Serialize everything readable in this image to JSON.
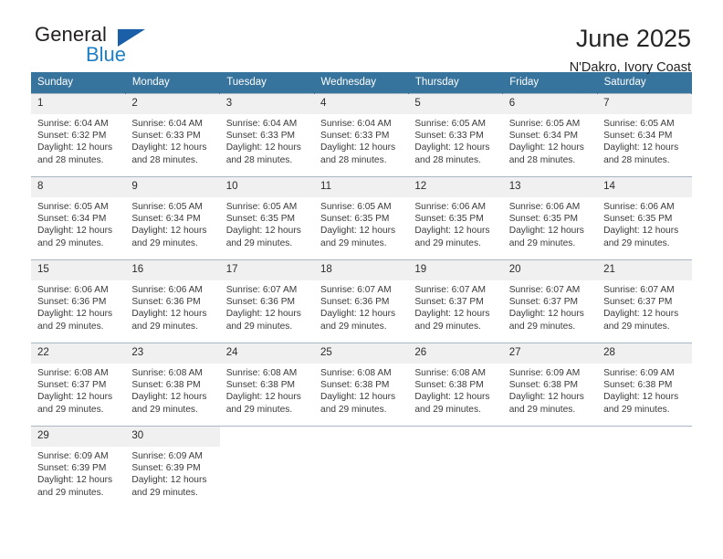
{
  "brand": {
    "line1": "General",
    "line2": "Blue",
    "flag_icon": "triangle-flag-icon",
    "accent_color": "#1f7fc4",
    "flag_color": "#1a5fa8"
  },
  "header": {
    "title": "June 2025",
    "subtitle": "N'Dakro, Ivory Coast"
  },
  "calendar": {
    "header_color": "#36739d",
    "daynum_background": "#f0f0f0",
    "weekdays": [
      "Sunday",
      "Monday",
      "Tuesday",
      "Wednesday",
      "Thursday",
      "Friday",
      "Saturday"
    ],
    "weeks": [
      [
        {
          "day": "1",
          "sunrise": "Sunrise: 6:04 AM",
          "sunset": "Sunset: 6:32 PM",
          "daylight_line1": "Daylight: 12 hours",
          "daylight_line2": "and 28 minutes."
        },
        {
          "day": "2",
          "sunrise": "Sunrise: 6:04 AM",
          "sunset": "Sunset: 6:33 PM",
          "daylight_line1": "Daylight: 12 hours",
          "daylight_line2": "and 28 minutes."
        },
        {
          "day": "3",
          "sunrise": "Sunrise: 6:04 AM",
          "sunset": "Sunset: 6:33 PM",
          "daylight_line1": "Daylight: 12 hours",
          "daylight_line2": "and 28 minutes."
        },
        {
          "day": "4",
          "sunrise": "Sunrise: 6:04 AM",
          "sunset": "Sunset: 6:33 PM",
          "daylight_line1": "Daylight: 12 hours",
          "daylight_line2": "and 28 minutes."
        },
        {
          "day": "5",
          "sunrise": "Sunrise: 6:05 AM",
          "sunset": "Sunset: 6:33 PM",
          "daylight_line1": "Daylight: 12 hours",
          "daylight_line2": "and 28 minutes."
        },
        {
          "day": "6",
          "sunrise": "Sunrise: 6:05 AM",
          "sunset": "Sunset: 6:34 PM",
          "daylight_line1": "Daylight: 12 hours",
          "daylight_line2": "and 28 minutes."
        },
        {
          "day": "7",
          "sunrise": "Sunrise: 6:05 AM",
          "sunset": "Sunset: 6:34 PM",
          "daylight_line1": "Daylight: 12 hours",
          "daylight_line2": "and 28 minutes."
        }
      ],
      [
        {
          "day": "8",
          "sunrise": "Sunrise: 6:05 AM",
          "sunset": "Sunset: 6:34 PM",
          "daylight_line1": "Daylight: 12 hours",
          "daylight_line2": "and 29 minutes."
        },
        {
          "day": "9",
          "sunrise": "Sunrise: 6:05 AM",
          "sunset": "Sunset: 6:34 PM",
          "daylight_line1": "Daylight: 12 hours",
          "daylight_line2": "and 29 minutes."
        },
        {
          "day": "10",
          "sunrise": "Sunrise: 6:05 AM",
          "sunset": "Sunset: 6:35 PM",
          "daylight_line1": "Daylight: 12 hours",
          "daylight_line2": "and 29 minutes."
        },
        {
          "day": "11",
          "sunrise": "Sunrise: 6:05 AM",
          "sunset": "Sunset: 6:35 PM",
          "daylight_line1": "Daylight: 12 hours",
          "daylight_line2": "and 29 minutes."
        },
        {
          "day": "12",
          "sunrise": "Sunrise: 6:06 AM",
          "sunset": "Sunset: 6:35 PM",
          "daylight_line1": "Daylight: 12 hours",
          "daylight_line2": "and 29 minutes."
        },
        {
          "day": "13",
          "sunrise": "Sunrise: 6:06 AM",
          "sunset": "Sunset: 6:35 PM",
          "daylight_line1": "Daylight: 12 hours",
          "daylight_line2": "and 29 minutes."
        },
        {
          "day": "14",
          "sunrise": "Sunrise: 6:06 AM",
          "sunset": "Sunset: 6:35 PM",
          "daylight_line1": "Daylight: 12 hours",
          "daylight_line2": "and 29 minutes."
        }
      ],
      [
        {
          "day": "15",
          "sunrise": "Sunrise: 6:06 AM",
          "sunset": "Sunset: 6:36 PM",
          "daylight_line1": "Daylight: 12 hours",
          "daylight_line2": "and 29 minutes."
        },
        {
          "day": "16",
          "sunrise": "Sunrise: 6:06 AM",
          "sunset": "Sunset: 6:36 PM",
          "daylight_line1": "Daylight: 12 hours",
          "daylight_line2": "and 29 minutes."
        },
        {
          "day": "17",
          "sunrise": "Sunrise: 6:07 AM",
          "sunset": "Sunset: 6:36 PM",
          "daylight_line1": "Daylight: 12 hours",
          "daylight_line2": "and 29 minutes."
        },
        {
          "day": "18",
          "sunrise": "Sunrise: 6:07 AM",
          "sunset": "Sunset: 6:36 PM",
          "daylight_line1": "Daylight: 12 hours",
          "daylight_line2": "and 29 minutes."
        },
        {
          "day": "19",
          "sunrise": "Sunrise: 6:07 AM",
          "sunset": "Sunset: 6:37 PM",
          "daylight_line1": "Daylight: 12 hours",
          "daylight_line2": "and 29 minutes."
        },
        {
          "day": "20",
          "sunrise": "Sunrise: 6:07 AM",
          "sunset": "Sunset: 6:37 PM",
          "daylight_line1": "Daylight: 12 hours",
          "daylight_line2": "and 29 minutes."
        },
        {
          "day": "21",
          "sunrise": "Sunrise: 6:07 AM",
          "sunset": "Sunset: 6:37 PM",
          "daylight_line1": "Daylight: 12 hours",
          "daylight_line2": "and 29 minutes."
        }
      ],
      [
        {
          "day": "22",
          "sunrise": "Sunrise: 6:08 AM",
          "sunset": "Sunset: 6:37 PM",
          "daylight_line1": "Daylight: 12 hours",
          "daylight_line2": "and 29 minutes."
        },
        {
          "day": "23",
          "sunrise": "Sunrise: 6:08 AM",
          "sunset": "Sunset: 6:38 PM",
          "daylight_line1": "Daylight: 12 hours",
          "daylight_line2": "and 29 minutes."
        },
        {
          "day": "24",
          "sunrise": "Sunrise: 6:08 AM",
          "sunset": "Sunset: 6:38 PM",
          "daylight_line1": "Daylight: 12 hours",
          "daylight_line2": "and 29 minutes."
        },
        {
          "day": "25",
          "sunrise": "Sunrise: 6:08 AM",
          "sunset": "Sunset: 6:38 PM",
          "daylight_line1": "Daylight: 12 hours",
          "daylight_line2": "and 29 minutes."
        },
        {
          "day": "26",
          "sunrise": "Sunrise: 6:08 AM",
          "sunset": "Sunset: 6:38 PM",
          "daylight_line1": "Daylight: 12 hours",
          "daylight_line2": "and 29 minutes."
        },
        {
          "day": "27",
          "sunrise": "Sunrise: 6:09 AM",
          "sunset": "Sunset: 6:38 PM",
          "daylight_line1": "Daylight: 12 hours",
          "daylight_line2": "and 29 minutes."
        },
        {
          "day": "28",
          "sunrise": "Sunrise: 6:09 AM",
          "sunset": "Sunset: 6:38 PM",
          "daylight_line1": "Daylight: 12 hours",
          "daylight_line2": "and 29 minutes."
        }
      ],
      [
        {
          "day": "29",
          "sunrise": "Sunrise: 6:09 AM",
          "sunset": "Sunset: 6:39 PM",
          "daylight_line1": "Daylight: 12 hours",
          "daylight_line2": "and 29 minutes."
        },
        {
          "day": "30",
          "sunrise": "Sunrise: 6:09 AM",
          "sunset": "Sunset: 6:39 PM",
          "daylight_line1": "Daylight: 12 hours",
          "daylight_line2": "and 29 minutes."
        },
        {
          "day": "",
          "sunrise": "",
          "sunset": "",
          "daylight_line1": "",
          "daylight_line2": ""
        },
        {
          "day": "",
          "sunrise": "",
          "sunset": "",
          "daylight_line1": "",
          "daylight_line2": ""
        },
        {
          "day": "",
          "sunrise": "",
          "sunset": "",
          "daylight_line1": "",
          "daylight_line2": ""
        },
        {
          "day": "",
          "sunrise": "",
          "sunset": "",
          "daylight_line1": "",
          "daylight_line2": ""
        },
        {
          "day": "",
          "sunrise": "",
          "sunset": "",
          "daylight_line1": "",
          "daylight_line2": ""
        }
      ]
    ]
  }
}
